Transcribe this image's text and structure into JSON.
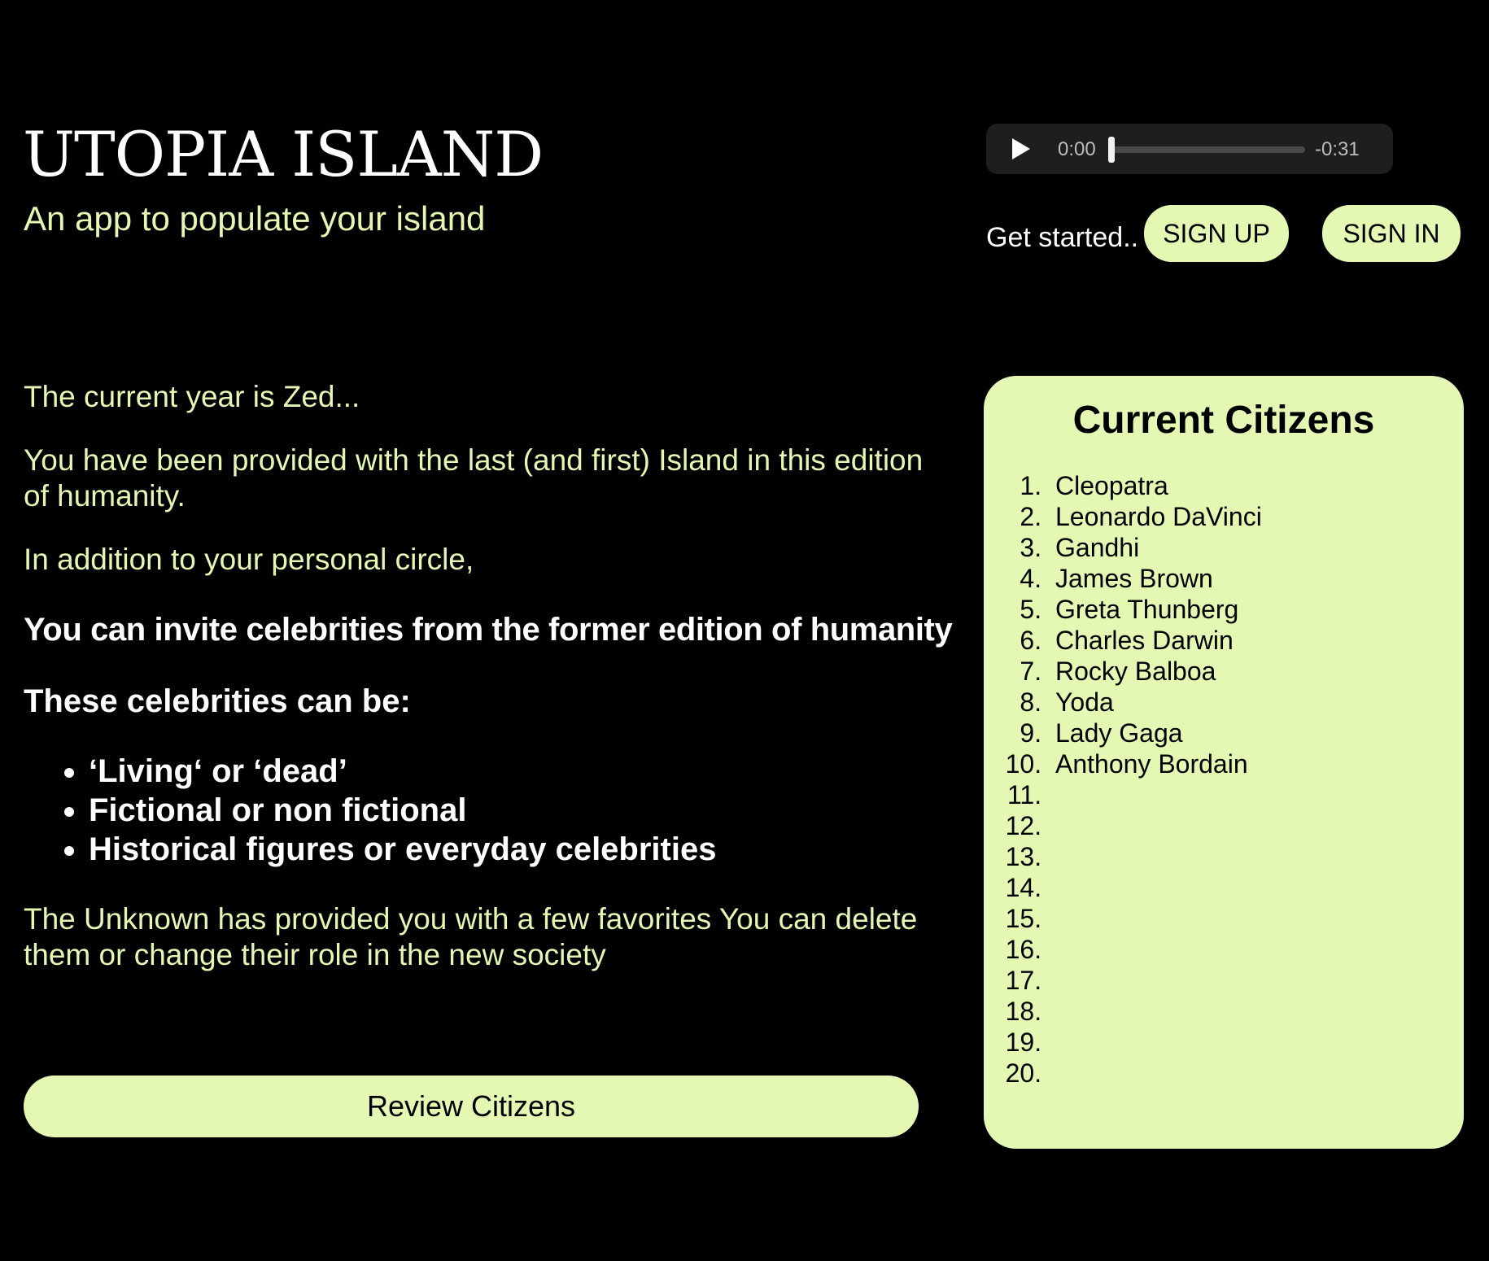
{
  "header": {
    "title": "UTOPIA ISLAND",
    "subtitle": "An app to populate your island"
  },
  "audio": {
    "elapsed": "0:00",
    "remaining": "-0:31",
    "progress": 0
  },
  "auth": {
    "get_started": "Get started..",
    "sign_up": "SIGN UP",
    "sign_in": "SIGN IN"
  },
  "intro": {
    "year": "The current year is Zed...",
    "island": "You have been provided with the last (and first) Island in this edition of humanity.",
    "addition": "In addition to your personal circle,",
    "invite": "You can invite celebrities from the former edition of humanity",
    "can_be": "These celebrities can be:",
    "bullets": [
      "‘Living‘ or ‘dead’",
      "Fictional or non fictional",
      "Historical figures or everyday celebrities"
    ],
    "unknown": "The Unknown has provided you with a few favorites You can delete them or change their role in the new society"
  },
  "review_button": "Review Citizens",
  "citizens": {
    "heading": "Current Citizens",
    "list": [
      "Cleopatra",
      "Leonardo DaVinci",
      "Gandhi",
      "James Brown",
      "Greta Thunberg",
      "Charles Darwin",
      "Rocky Balboa",
      "Yoda",
      "Lady Gaga",
      "Anthony Bordain",
      "",
      "",
      "",
      "",
      "",
      "",
      "",
      "",
      "",
      ""
    ]
  },
  "colors": {
    "background": "#000000",
    "accent": "#e4f8b4",
    "text_white": "#ffffff",
    "player_bg": "#1e1e1e"
  }
}
